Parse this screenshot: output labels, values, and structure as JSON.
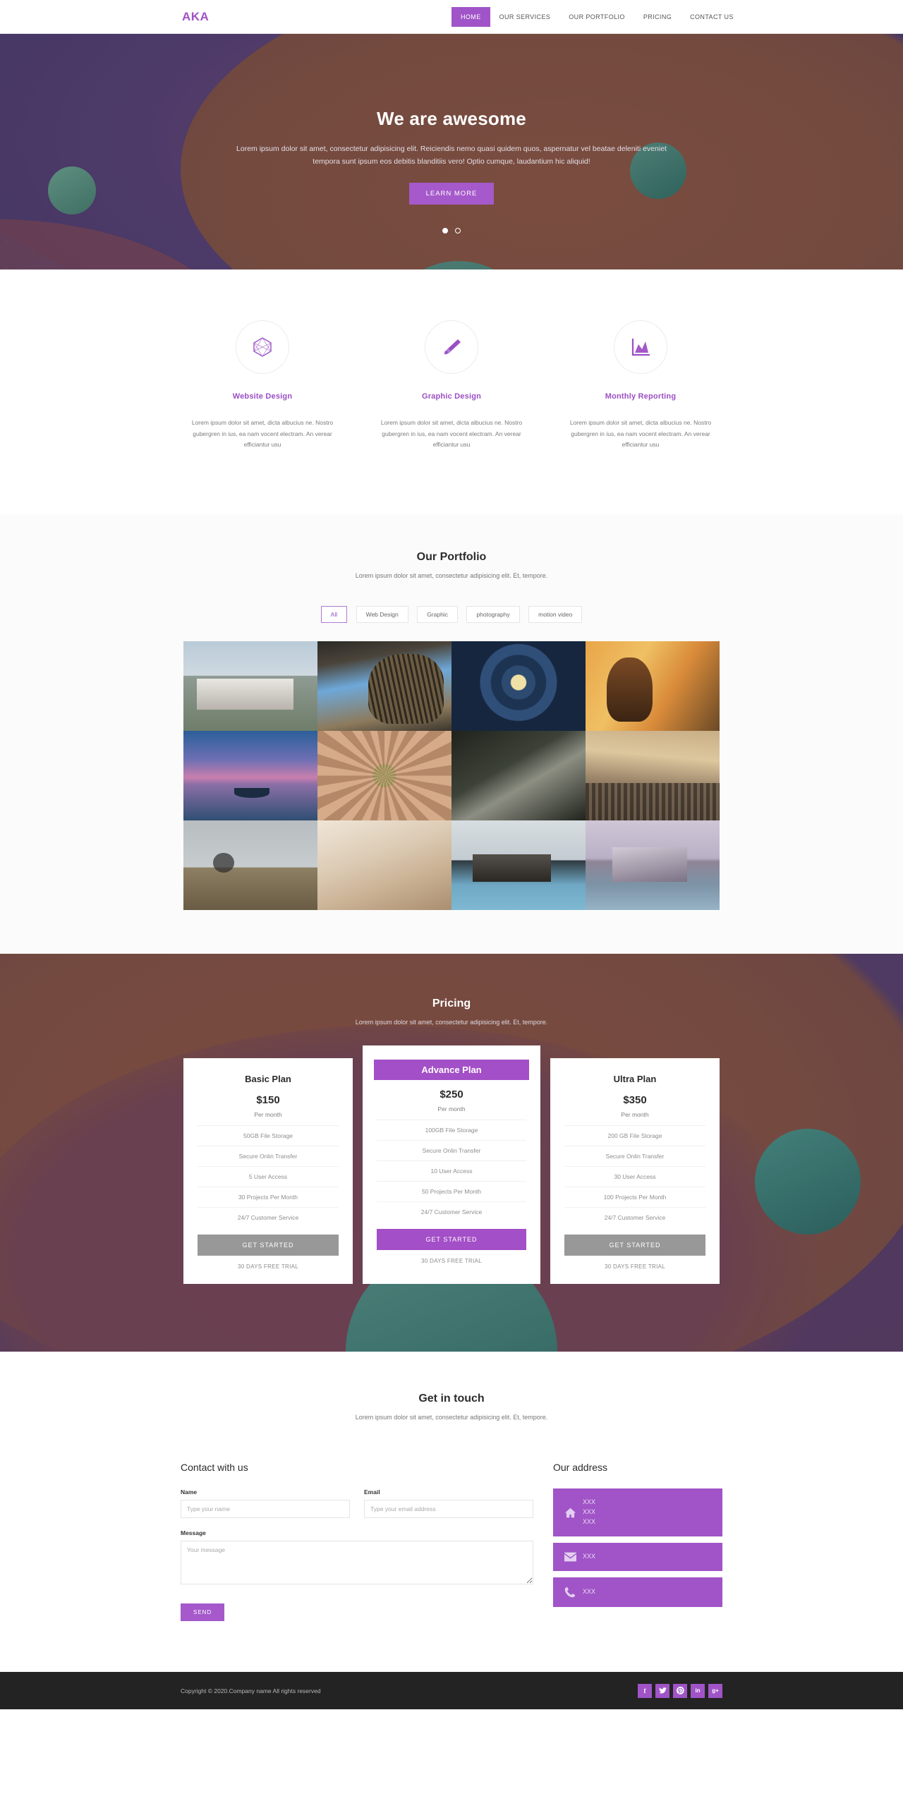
{
  "nav": {
    "brand": "AKA",
    "items": [
      {
        "label": "HOME",
        "active": true
      },
      {
        "label": "OUR SERVICES",
        "active": false
      },
      {
        "label": "OUR PORTFOLIO",
        "active": false
      },
      {
        "label": "PRICING",
        "active": false
      },
      {
        "label": "CONTACT US",
        "active": false
      }
    ]
  },
  "hero": {
    "title": "We are awesome",
    "subtitle": "Lorem ipsum dolor sit amet, consectetur adipisicing elit. Reiciendis nemo quasi quidem quos, aspernatur vel beatae deleniti eveniet tempora sunt ipsum eos debitis blanditiis vero! Optio cumque, laudantium hic aliquid!",
    "cta": "LEARN MORE",
    "slides": 2,
    "active_slide": 1,
    "accent": "#a559ca"
  },
  "services": [
    {
      "icon": "hexagon-wireframe-icon",
      "title": "Website Design",
      "desc": "Lorem ipsum dolor sit amet, dicta albucius ne. Nostro gubergren in ius, ea nam vocent electram. An verear efficiantur usu"
    },
    {
      "icon": "paintbrush-icon",
      "title": "Graphic Design",
      "desc": "Lorem ipsum dolor sit amet, dicta albucius ne. Nostro gubergren in ius, ea nam vocent electram. An verear efficiantur usu"
    },
    {
      "icon": "chart-area-icon",
      "title": "Monthly Reporting",
      "desc": "Lorem ipsum dolor sit amet, dicta albucius ne. Nostro gubergren in ius, ea nam vocent electram. An verear efficiantur usu"
    }
  ],
  "portfolio": {
    "title": "Our Portfolio",
    "subtitle": "Lorem ipsum dolor sit amet, consectetur adipisicing elit. Et, tempore.",
    "filters": [
      {
        "label": "All",
        "active": true
      },
      {
        "label": "Web Design",
        "active": false
      },
      {
        "label": "Graphic",
        "active": false
      },
      {
        "label": "photography",
        "active": false
      },
      {
        "label": "motion video",
        "active": false
      }
    ],
    "items": [
      {
        "name": "modern-house-exterior",
        "style": "ph-house1"
      },
      {
        "name": "curved-timber-building",
        "style": "ph-arch"
      },
      {
        "name": "stained-glass-dome",
        "style": "ph-dome"
      },
      {
        "name": "woman-in-sunset-field",
        "style": "ph-field"
      },
      {
        "name": "boat-at-purple-sunset",
        "style": "ph-boat"
      },
      {
        "name": "hands-circle-on-grass",
        "style": "ph-hands"
      },
      {
        "name": "man-in-suit-dark",
        "style": "ph-suit"
      },
      {
        "name": "city-street-crowd",
        "style": "ph-street"
      },
      {
        "name": "cyclist-on-cliff",
        "style": "ph-bike"
      },
      {
        "name": "sand-dune-abstract",
        "style": "ph-sand"
      },
      {
        "name": "villa-with-pool-night",
        "style": "ph-pool1"
      },
      {
        "name": "modern-villa-dusk",
        "style": "ph-pool2"
      }
    ]
  },
  "pricing": {
    "title": "Pricing",
    "subtitle": "Lorem ipsum dolor sit amet, consectetur adipisicing elit. Et, tempore.",
    "plans": [
      {
        "name": "Basic Plan",
        "price": "$150",
        "period": "Per month",
        "featured": false,
        "features": [
          "50GB File Storage",
          "Secure Onlin Transfer",
          "5 User Access",
          "30 Projects Per Month",
          "24/7 Customer Service"
        ],
        "button": "GET STARTED",
        "trial": "30 DAYS FREE TRIAL"
      },
      {
        "name": "Advance Plan",
        "price": "$250",
        "period": "Per month",
        "featured": true,
        "features": [
          "100GB File Storage",
          "Secure Onlin Transfer",
          "10 User Access",
          "50 Projects Per Month",
          "24/7 Customer Service"
        ],
        "button": "GET STARTED",
        "trial": "30 DAYS FREE TRIAL"
      },
      {
        "name": "Ultra Plan",
        "price": "$350",
        "period": "Per month",
        "featured": false,
        "features": [
          "200 GB File Storage",
          "Secure Onlin Transfer",
          "30 User Access",
          "100 Projects Per Month",
          "24/7 Customer Service"
        ],
        "button": "GET STARTED",
        "trial": "30 DAYS FREE TRIAL"
      }
    ]
  },
  "contact": {
    "title": "Get in touch",
    "subtitle": "Lorem ipsum dolor sit amet, consectetur adipisicing elit. Et, tempore.",
    "form_heading": "Contact with us",
    "name_label": "Name",
    "name_placeholder": "Type your name",
    "email_label": "Email",
    "email_placeholder": "Type your email address",
    "message_label": "Message",
    "message_placeholder": "Your message",
    "send_label": "SEND",
    "address_heading": "Our address",
    "address_cards": [
      {
        "icon": "home-icon",
        "lines": "XXX\nXXX\nXXX"
      },
      {
        "icon": "envelope-icon",
        "lines": "XXX"
      },
      {
        "icon": "phone-icon",
        "lines": "XXX"
      }
    ]
  },
  "footer": {
    "copyright": "Copyright © 2020.Company name All rights reserved",
    "socials": [
      {
        "name": "facebook-icon",
        "glyph": "f"
      },
      {
        "name": "twitter-icon",
        "glyph": "ᴠ"
      },
      {
        "name": "pinterest-icon",
        "glyph": "ⓟ"
      },
      {
        "name": "linkedin-icon",
        "glyph": "in"
      },
      {
        "name": "googleplus-icon",
        "glyph": "g+"
      }
    ]
  },
  "colors": {
    "brand_purple": "#a054c7",
    "accent": "#a559ca",
    "service_title": "#9b4fc4",
    "footer_bg": "#232323"
  }
}
